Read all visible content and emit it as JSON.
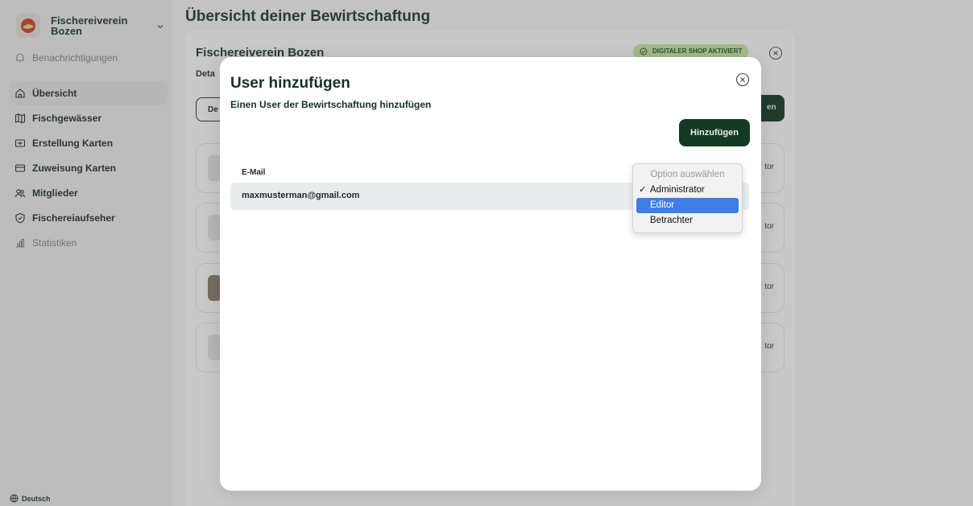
{
  "sidebar": {
    "org_name": "Fischereiverein Bozen",
    "items": [
      {
        "label": "Benachrichtigungen"
      },
      {
        "label": "Übersicht"
      },
      {
        "label": "Fischgewässer"
      },
      {
        "label": "Erstellung Karten"
      },
      {
        "label": "Zuweisung Karten"
      },
      {
        "label": "Mitglieder"
      },
      {
        "label": "Fischereiaufseher"
      },
      {
        "label": "Statistiken"
      }
    ],
    "language": "Deutsch"
  },
  "page": {
    "title": "Übersicht deiner Bewirtschaftung",
    "card_heading": "Fischereiverein Bozen",
    "card_sub": "Deta",
    "tab_partial": "De",
    "badge": "DIGITALER SHOP AKTIVIERT",
    "button_partial": "en",
    "row_tail": "tor"
  },
  "modal": {
    "title": "User hinzufügen",
    "subtitle": "Einen User der Bewirtschaftung hinzufügen",
    "add_button": "Hinzufügen",
    "email_label": "E-Mail",
    "email_value": "maxmusterman@gmail.com"
  },
  "role_dropdown": {
    "placeholder": "Option auswählen",
    "options": [
      "Administrator",
      "Editor",
      "Betrachter"
    ],
    "checked": "Administrator",
    "highlighted": "Editor"
  },
  "colors": {
    "brand_green": "#143a25",
    "badge_green": "#c9e8a4",
    "highlight_blue": "#3f7de4"
  }
}
